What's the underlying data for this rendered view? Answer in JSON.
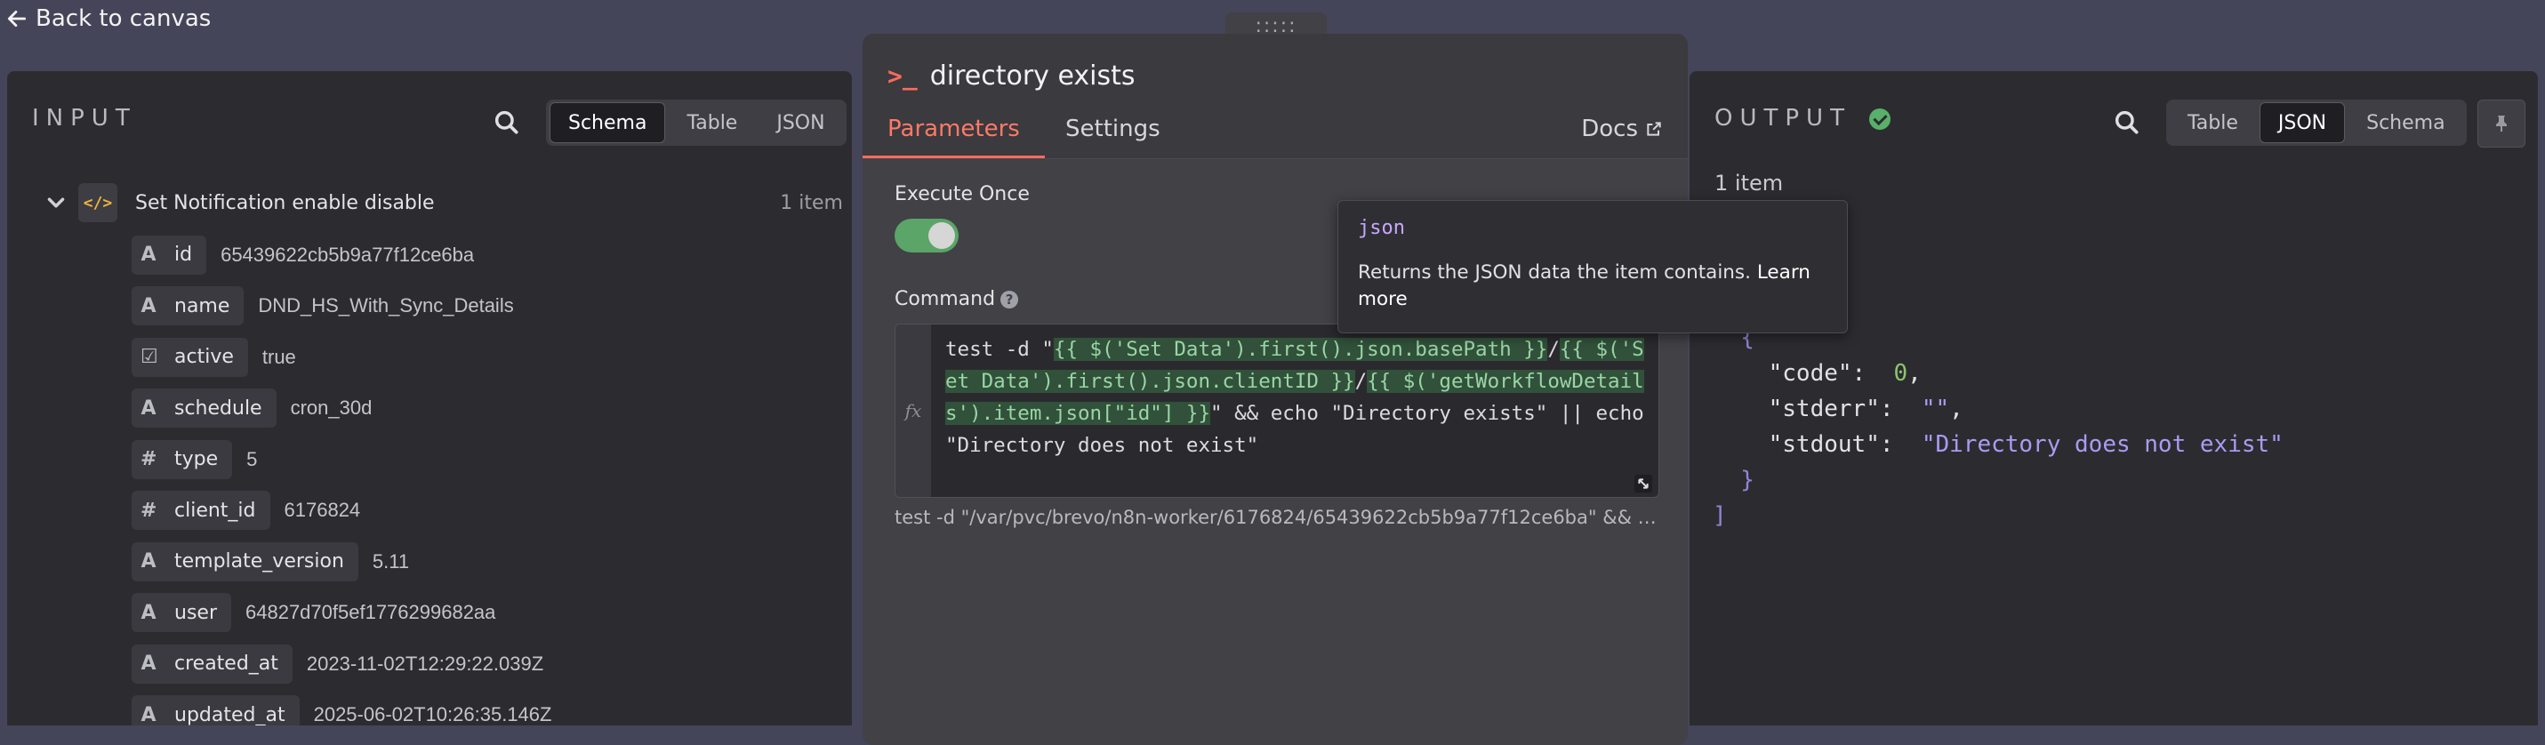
{
  "back": {
    "label": "Back to canvas"
  },
  "input": {
    "title": "INPUT",
    "tabs": [
      "Schema",
      "Table",
      "JSON"
    ],
    "active_tab": "Schema",
    "node": {
      "name": "Set Notification enable disable",
      "count": "1 item"
    },
    "fields": [
      {
        "type": "A",
        "key": "id",
        "value": "65439622cb5b9a77f12ce6ba"
      },
      {
        "type": "A",
        "key": "name",
        "value": "DND_HS_With_Sync_Details"
      },
      {
        "type": "☑",
        "key": "active",
        "value": "true"
      },
      {
        "type": "A",
        "key": "schedule",
        "value": "cron_30d"
      },
      {
        "type": "#",
        "key": "type",
        "value": "5"
      },
      {
        "type": "#",
        "key": "client_id",
        "value": "6176824"
      },
      {
        "type": "A",
        "key": "template_version",
        "value": "5.11"
      },
      {
        "type": "A",
        "key": "user",
        "value": "64827d70f5ef1776299682aa"
      },
      {
        "type": "A",
        "key": "created_at",
        "value": "2023-11-02T12:29:22.039Z"
      },
      {
        "type": "A",
        "key": "updated_at",
        "value": "2025-06-02T10:26:35.146Z"
      }
    ]
  },
  "modal": {
    "grip": ":::::",
    "title": "directory exists",
    "tabs": {
      "parameters": "Parameters",
      "settings": "Settings",
      "docs": "Docs"
    },
    "execute_once": {
      "label": "Execute Once",
      "enabled": true
    },
    "command": {
      "label": "Command",
      "parts": [
        {
          "t": "test -d \"",
          "hl": false
        },
        {
          "t": "{{ $('Set Data').first().json.basePath }}",
          "hl": true
        },
        {
          "t": "/",
          "hl": false
        },
        {
          "t": "{{ $('Set Data').first().json.clientID }}",
          "hl": true
        },
        {
          "t": "/",
          "hl": false
        },
        {
          "t": "{{ $('getWorkflowDetails').item.json[\"id\"] }}",
          "hl": true
        },
        {
          "t": "\" && echo \"Directory exists\" || echo \"Directory does not exist\"",
          "hl": false
        }
      ],
      "preview": "test -d \"/var/pvc/brevo/n8n-worker/6176824/65439622cb5b9a77f12ce6ba\" && ech..."
    }
  },
  "tooltip": {
    "title": "json",
    "body": "Returns the JSON data the item contains.",
    "link": "Learn more"
  },
  "output": {
    "title": "OUTPUT",
    "tabs": [
      "Table",
      "JSON",
      "Schema"
    ],
    "active_tab": "JSON",
    "count": "1 item",
    "json_lines": [
      {
        "key": "\"code\"",
        "value": "0",
        "vtype": "number",
        "comma": true
      },
      {
        "key": "\"stderr\"",
        "value": "\"\"",
        "vtype": "string",
        "comma": true
      },
      {
        "key": "\"stdout\"",
        "value": "\"Directory does not exist\"",
        "vtype": "string",
        "comma": false
      }
    ]
  },
  "colors": {
    "accent": "#ff6d5a",
    "success": "#58b06a",
    "toggle_on": "#5aa567",
    "string": "#a89cf3",
    "number": "#8cc56d"
  }
}
